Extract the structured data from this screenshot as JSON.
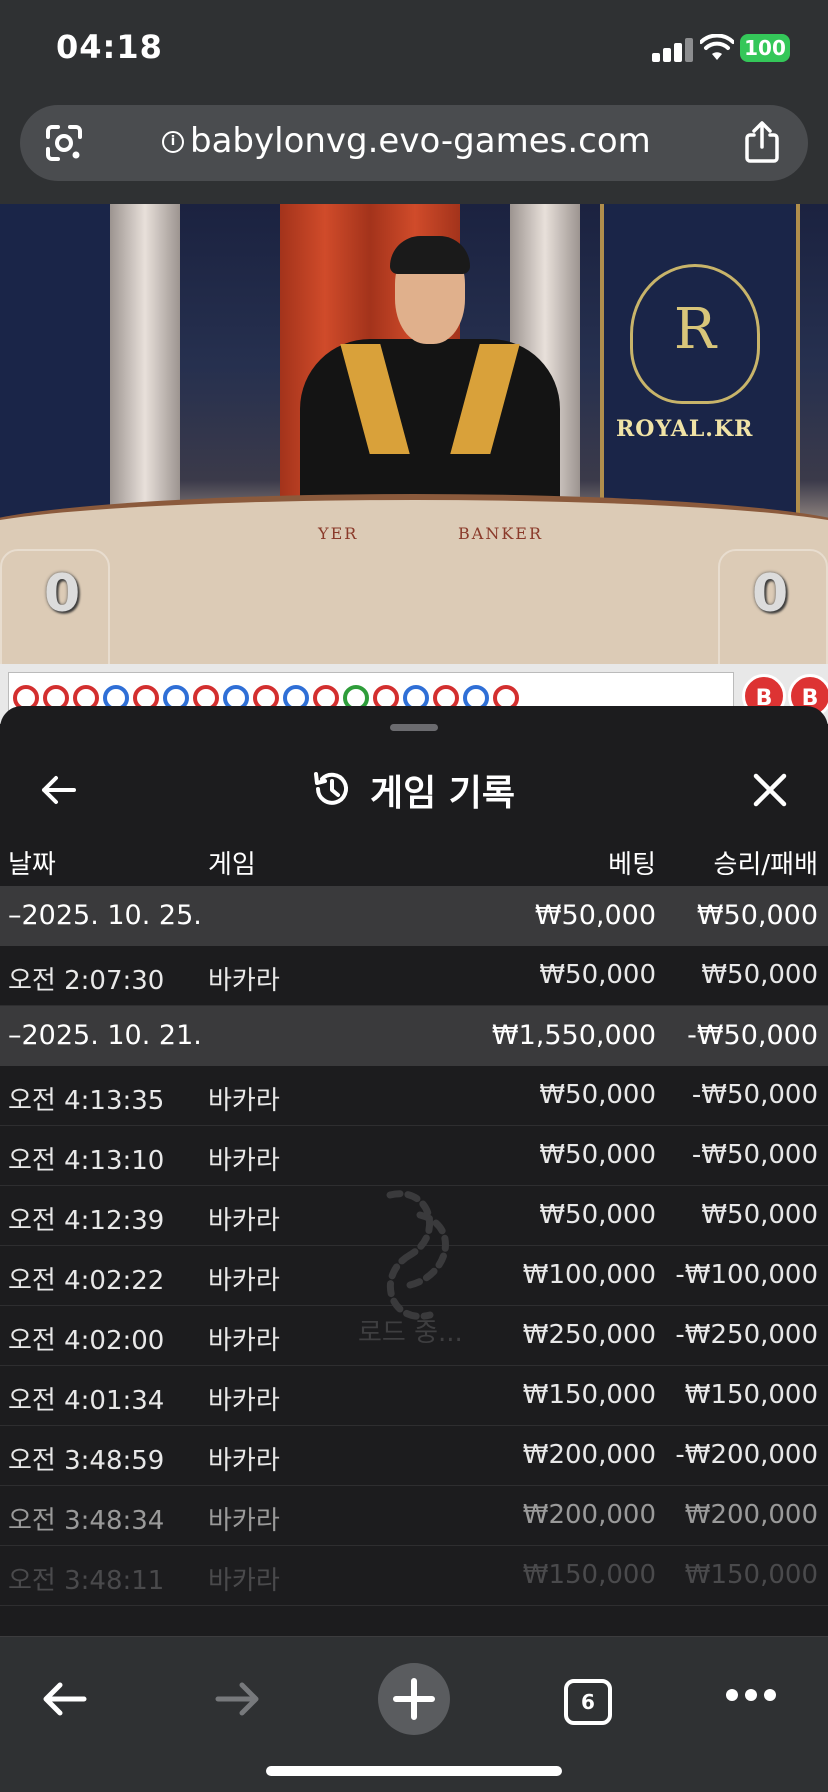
{
  "status": {
    "time": "04:18",
    "battery": "100"
  },
  "browser": {
    "url": "babylonvg.evo-games.com",
    "info_glyph": "i",
    "tabs_count": "6"
  },
  "stream": {
    "brand_label": "ROYAL.KR",
    "crest_letter": "R",
    "table_player_label": "YER",
    "table_banker_label": "BANKER",
    "player_score": "0",
    "banker_score": "0",
    "road_buttons": [
      "B",
      "B"
    ]
  },
  "sheet": {
    "title": "게임 기록",
    "columns": {
      "date": "날짜",
      "game": "게임",
      "bet": "베팅",
      "win_loss": "승리/패배"
    },
    "rows": [
      {
        "type": "group",
        "date": "–2025. 10. 25.",
        "game": "",
        "bet": "₩50,000",
        "win": "₩50,000"
      },
      {
        "type": "item",
        "date": "오전 2:07:30",
        "game": "바카라",
        "bet": "₩50,000",
        "win": "₩50,000"
      },
      {
        "type": "group",
        "date": "–2025. 10. 21.",
        "game": "",
        "bet": "₩1,550,000",
        "win": "-₩50,000"
      },
      {
        "type": "item",
        "date": "오전 4:13:35",
        "game": "바카라",
        "bet": "₩50,000",
        "win": "-₩50,000"
      },
      {
        "type": "item",
        "date": "오전 4:13:10",
        "game": "바카라",
        "bet": "₩50,000",
        "win": "-₩50,000"
      },
      {
        "type": "item",
        "date": "오전 4:12:39",
        "game": "바카라",
        "bet": "₩50,000",
        "win": "₩50,000"
      },
      {
        "type": "item",
        "date": "오전 4:02:22",
        "game": "바카라",
        "bet": "₩100,000",
        "win": "-₩100,000"
      },
      {
        "type": "item",
        "date": "오전 4:02:00",
        "game": "바카라",
        "bet": "₩250,000",
        "win": "-₩250,000"
      },
      {
        "type": "item",
        "date": "오전 4:01:34",
        "game": "바카라",
        "bet": "₩150,000",
        "win": "₩150,000"
      },
      {
        "type": "item",
        "date": "오전 3:48:59",
        "game": "바카라",
        "bet": "₩200,000",
        "win": "-₩200,000"
      },
      {
        "type": "item",
        "date": "오전 3:48:34",
        "game": "바카라",
        "bet": "₩200,000",
        "win": "₩200,000"
      },
      {
        "type": "item",
        "date": "오전 3:48:11",
        "game": "바카라",
        "bet": "₩150,000",
        "win": "₩150,000"
      }
    ],
    "loading_text": "로드 중..."
  },
  "colors": {
    "player_blue": "#2f6fd6",
    "banker_red": "#d32f2f",
    "tie_green": "#2e9d3a",
    "battery_green": "#34c759"
  }
}
